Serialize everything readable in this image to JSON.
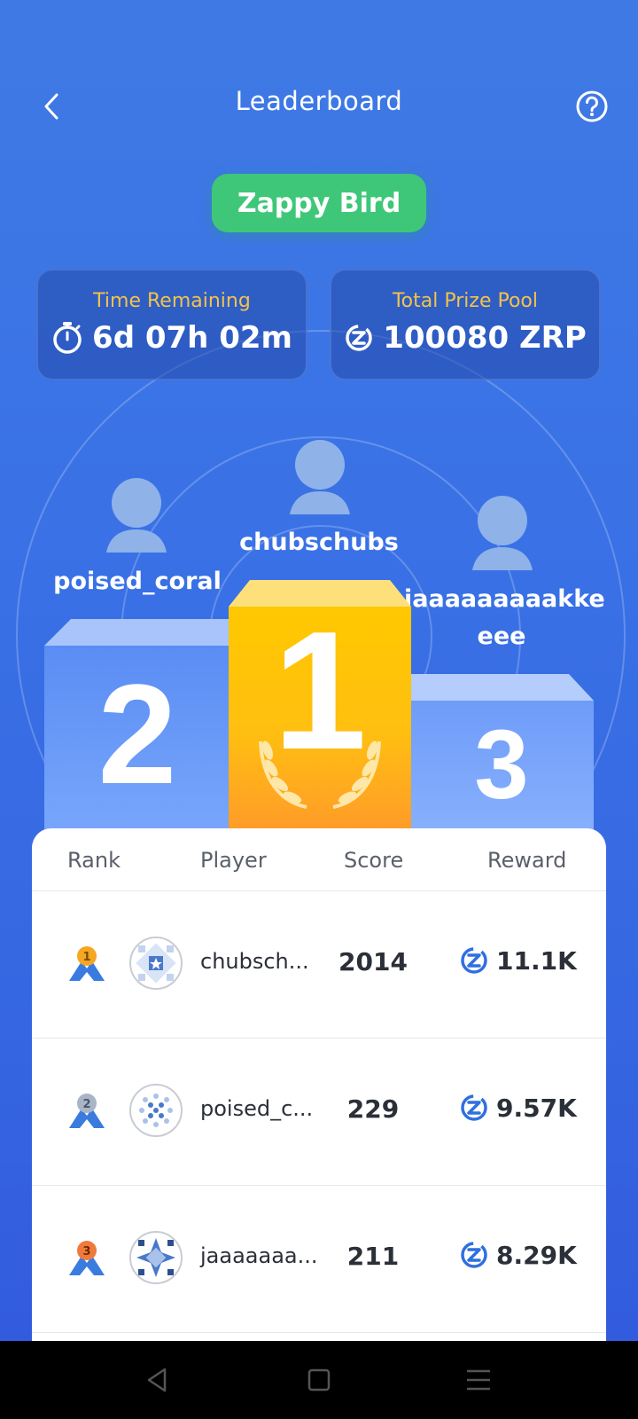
{
  "header": {
    "title": "Leaderboard",
    "back_icon": "chevron-left-icon",
    "help_icon": "question-circle-icon"
  },
  "game": {
    "name": "Zappy Bird",
    "color": "#3fc779"
  },
  "stats": {
    "time_remaining": {
      "label": "Time Remaining",
      "value": "6d 07h 02m",
      "icon": "stopwatch-icon"
    },
    "prize_pool": {
      "label": "Total Prize Pool",
      "value": "100080 ZRP",
      "icon": "zrp-coin-icon"
    }
  },
  "podium": {
    "first": {
      "rank": "1",
      "name": "chubschubs"
    },
    "second": {
      "rank": "2",
      "name": "poised_coral"
    },
    "third": {
      "rank": "3",
      "name_line1": "jaaaaaaaaakke",
      "name_line2": "eee"
    }
  },
  "table": {
    "columns": [
      "Rank",
      "Player",
      "Score",
      "Reward"
    ],
    "rows": [
      {
        "rank": "1",
        "player": "chubsch...",
        "score": "2014",
        "reward": "11.1K",
        "badge_color": "#f5a623"
      },
      {
        "rank": "2",
        "player": "poised_c...",
        "score": "229",
        "reward": "9.57K",
        "badge_color": "#a9b4c6"
      },
      {
        "rank": "3",
        "player": "jaaaaaaa...",
        "score": "211",
        "reward": "8.29K",
        "badge_color": "#f07a3c"
      }
    ]
  },
  "navbar": {
    "back": "nav-back-icon",
    "home": "nav-home-icon",
    "menu": "nav-menu-icon"
  },
  "colors": {
    "accent_gold": "#f3c34a",
    "background": "#3a72e6",
    "reward_icon": "#2f6fe0"
  }
}
